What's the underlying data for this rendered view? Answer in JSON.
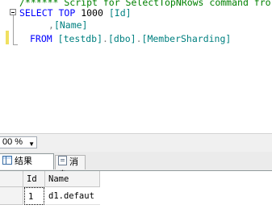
{
  "editor": {
    "comment_line": "/****** Script for SelectTopNRows command fro",
    "select_kw": "SELECT",
    "top_kw": "TOP",
    "top_count": "1000",
    "col_id": "[Id]",
    "comma": ",",
    "col_name": "[Name]",
    "from_kw": "FROM",
    "table_db": "[testdb]",
    "dot1": ".",
    "table_schema": "[dbo]",
    "dot2": ".",
    "table_name": "[MemberSharding]"
  },
  "zoom": {
    "value": "00 %"
  },
  "tabs": {
    "results_label": "结果",
    "messages_label": "消息"
  },
  "grid": {
    "columns": [
      "Id",
      "Name"
    ],
    "rows": [
      {
        "id": "1",
        "name": "d1.defaut"
      }
    ]
  }
}
